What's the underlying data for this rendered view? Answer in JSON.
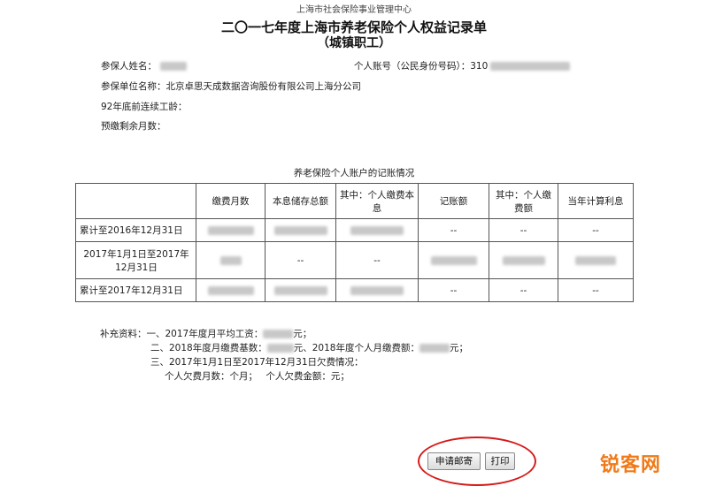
{
  "header": {
    "org": "上海市社会保险事业管理中心",
    "title": "二〇一七年度上海市养老保险个人权益记录单",
    "subtitle": "（城镇职工）"
  },
  "info": {
    "name_label": "参保人姓名：",
    "account_label": "个人账号（公民身份号码）：",
    "account_prefix": "310",
    "employer_label": "参保单位名称：",
    "employer_value": "北京卓思天成数据咨询股份有限公司上海分公司",
    "seniority_label": "92年底前连续工龄：",
    "remaining_label": "预缴剩余月数："
  },
  "table": {
    "caption": "养老保险个人账户的记账情况",
    "headers": [
      "",
      "缴费月数",
      "本息储存总额",
      "其中：个人缴费本息",
      "记账额",
      "其中：个人缴费额",
      "当年计算利息"
    ],
    "rows": [
      {
        "label": "累计至2016年12月31日",
        "cells": [
          "",
          "",
          "",
          "--",
          "--",
          "--"
        ]
      },
      {
        "label": "2017年1月1日至2017年12月31日",
        "cells": [
          "",
          "--",
          "--",
          "",
          "",
          ""
        ]
      },
      {
        "label": "累计至2017年12月31日",
        "cells": [
          "",
          "",
          "",
          "--",
          "--",
          "--"
        ]
      }
    ],
    "dash": "--"
  },
  "supplement": {
    "label": "补充资料：",
    "line1_a": "一、2017年度月平均工资：",
    "line1_b": "元；",
    "line2_a": "二、2018年度月缴费基数：",
    "line2_b": "元、2018年度个人月缴费额：",
    "line2_c": "元；",
    "line3": "三、2017年1月1日至2017年12月31日欠费情况：",
    "line4_a": "个人欠费月数：",
    "line4_b": "个月；",
    "line4_c": "个人欠费金额：",
    "line4_d": "元；"
  },
  "buttons": {
    "apply_mail": "申请邮寄",
    "print": "打印"
  },
  "watermark": "锐客网"
}
